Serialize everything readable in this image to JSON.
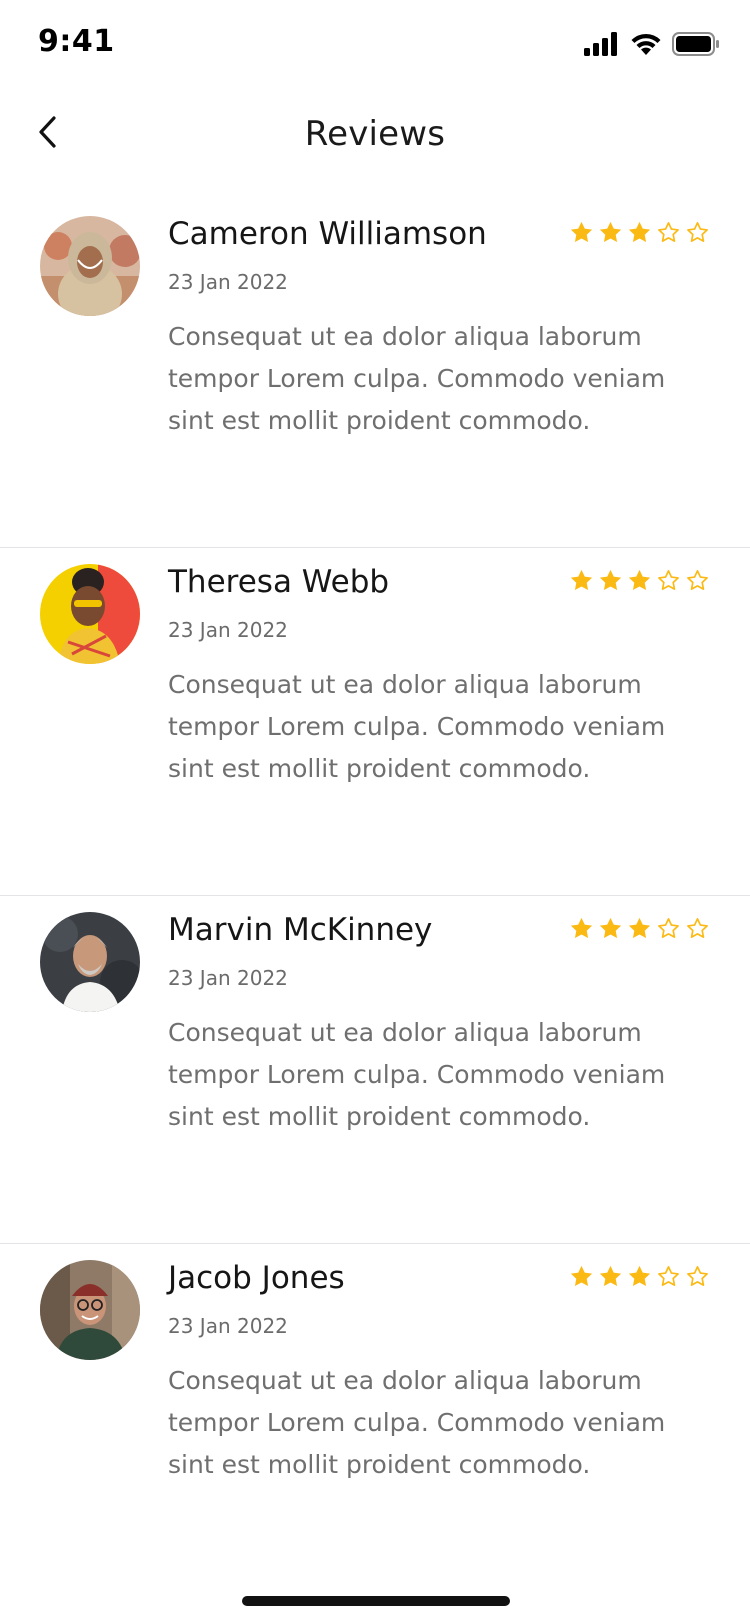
{
  "status_bar": {
    "time": "9:41",
    "icons": [
      "signal-icon",
      "wifi-icon",
      "battery-icon"
    ]
  },
  "header": {
    "back_icon": "chevron-left-icon",
    "title": "Reviews"
  },
  "colors": {
    "star_filled": "#FBB914",
    "text_primary": "#161616",
    "text_secondary": "#6F6F6F",
    "divider": "#E3E3E8"
  },
  "reviews": [
    {
      "name": "Cameron Williamson",
      "date": "23 Jan 2022",
      "rating": 3,
      "max_rating": 5,
      "text": "Consequat ut ea dolor aliqua laborum tempor Lorem culpa. Commodo veniam sint est mollit proident commodo."
    },
    {
      "name": "Theresa Webb",
      "date": "23 Jan 2022",
      "rating": 3,
      "max_rating": 5,
      "text": "Consequat ut ea dolor aliqua laborum tempor Lorem culpa. Commodo veniam sint est mollit proident commodo."
    },
    {
      "name": "Marvin McKinney",
      "date": "23 Jan 2022",
      "rating": 3,
      "max_rating": 5,
      "text": "Consequat ut ea dolor aliqua laborum tempor Lorem culpa. Commodo veniam sint est mollit proident commodo."
    },
    {
      "name": "Jacob Jones",
      "date": "23 Jan 2022",
      "rating": 3,
      "max_rating": 5,
      "text": "Consequat ut ea dolor aliqua laborum tempor Lorem culpa. Commodo veniam sint est mollit proident commodo."
    }
  ]
}
